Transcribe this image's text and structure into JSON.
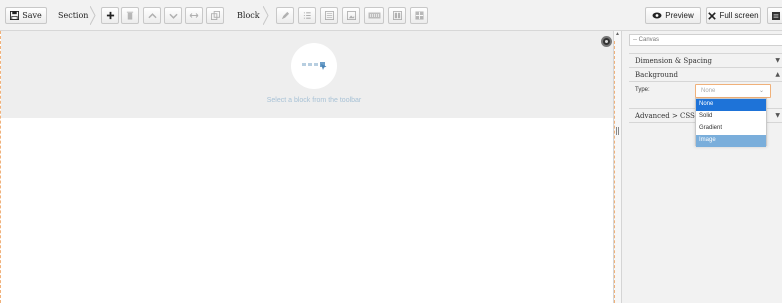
{
  "toolbar": {
    "save_label": "Save",
    "section_label": "Section",
    "block_label": "Block",
    "preview_label": "Preview",
    "fullscreen_label": "Full screen",
    "section_tools": [
      "add-icon",
      "delete-icon",
      "move-up-icon",
      "move-down-icon",
      "resize-horizontal-icon",
      "duplicate-icon"
    ],
    "block_tools": [
      "edit-icon",
      "list-icon",
      "text-block-icon",
      "image-icon",
      "html-icon",
      "columns-icon",
      "grid-icon"
    ],
    "block_tools_disabled": true
  },
  "canvas": {
    "placeholder_text": "Select a block from the toolbar",
    "block_icon": "select-block-icon"
  },
  "panel": {
    "canvas_dropdown": "-- Canvas",
    "sections": {
      "dimension": "Dimension & Spacing",
      "background": "Background",
      "advanced": "Advanced > CSS"
    },
    "type_label": "Type:",
    "type_value": "None",
    "type_options": [
      "None",
      "Solid",
      "Gradient",
      "Image"
    ],
    "selected_option": "None",
    "hovered_option": "Image"
  },
  "colors": {
    "accent_orange": "#f0b17a",
    "selected_blue": "#1e73d8",
    "hover_blue": "#7aaedb",
    "placeholder_text": "#a8c2d6"
  }
}
